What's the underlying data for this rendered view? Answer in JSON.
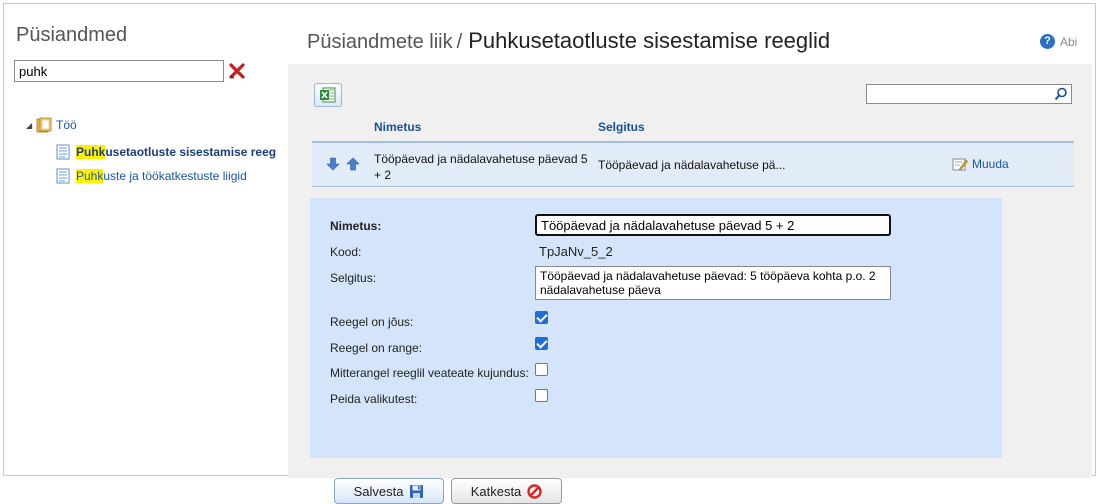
{
  "left_panel": {
    "title": "Püsiandmed",
    "search_value": "puhk",
    "tree": {
      "root_label": "Töö",
      "items": [
        {
          "highlight": "Puhk",
          "rest": "usetaotluste sisestamise reeg",
          "selected": true
        },
        {
          "highlight": "Puhk",
          "rest": "uste ja töökatkestuste liigid",
          "selected": false
        }
      ]
    }
  },
  "header": {
    "breadcrumb_parent": "Püsiandmete liik",
    "breadcrumb_separator": "/",
    "title": "Puhkusetaotluste sisestamise reeglid",
    "help_label": "Abi"
  },
  "grid": {
    "search_value": "",
    "columns": [
      "Nimetus",
      "Selgitus"
    ],
    "rows": [
      {
        "name": "Tööpäevad ja nädalavahetuse päevad 5 + 2",
        "description": "Tööpäevad ja nädalavahetuse pä...",
        "edit_label": "Muuda"
      }
    ]
  },
  "form": {
    "labels": {
      "name": "Nimetus:",
      "code": "Kood:",
      "description": "Selgitus:",
      "in_force": "Reegel on jõus:",
      "strict": "Reegel on range:",
      "non_strict_format": "Mitterangel reeglil veateate kujundus:",
      "hide": "Peida valikutest:"
    },
    "values": {
      "name": "Tööpäevad ja nädalavahetuse päevad 5 + 2",
      "code": "TpJaNv_5_2",
      "description": "Tööpäevad ja nädalavahetuse päevad: 5 tööpäeva kohta p.o. 2 nädalavahetuse päeva",
      "in_force": true,
      "strict": true,
      "non_strict_format": false,
      "hide": false
    },
    "buttons": {
      "save": "Salvesta",
      "cancel": "Katkesta"
    }
  },
  "colors": {
    "link": "#1a55a8",
    "header_blue": "#1a4f9c",
    "form_bg": "#d4e5fb",
    "row_bg": "#e2ecf8",
    "checkbox": "#1d6fd6",
    "highlight": "#fff200"
  },
  "icons": {
    "clear_search": "red-x-clear-icon",
    "tree_folder": "folder-icon",
    "tree_doc": "document-icon",
    "excel_export": "excel-icon",
    "grid_search": "magnifier-icon",
    "move_down": "arrow-down-icon",
    "move_up": "arrow-up-icon",
    "edit": "edit-icon",
    "save": "floppy-disk-icon",
    "cancel": "cancel-icon",
    "help": "help-icon"
  }
}
